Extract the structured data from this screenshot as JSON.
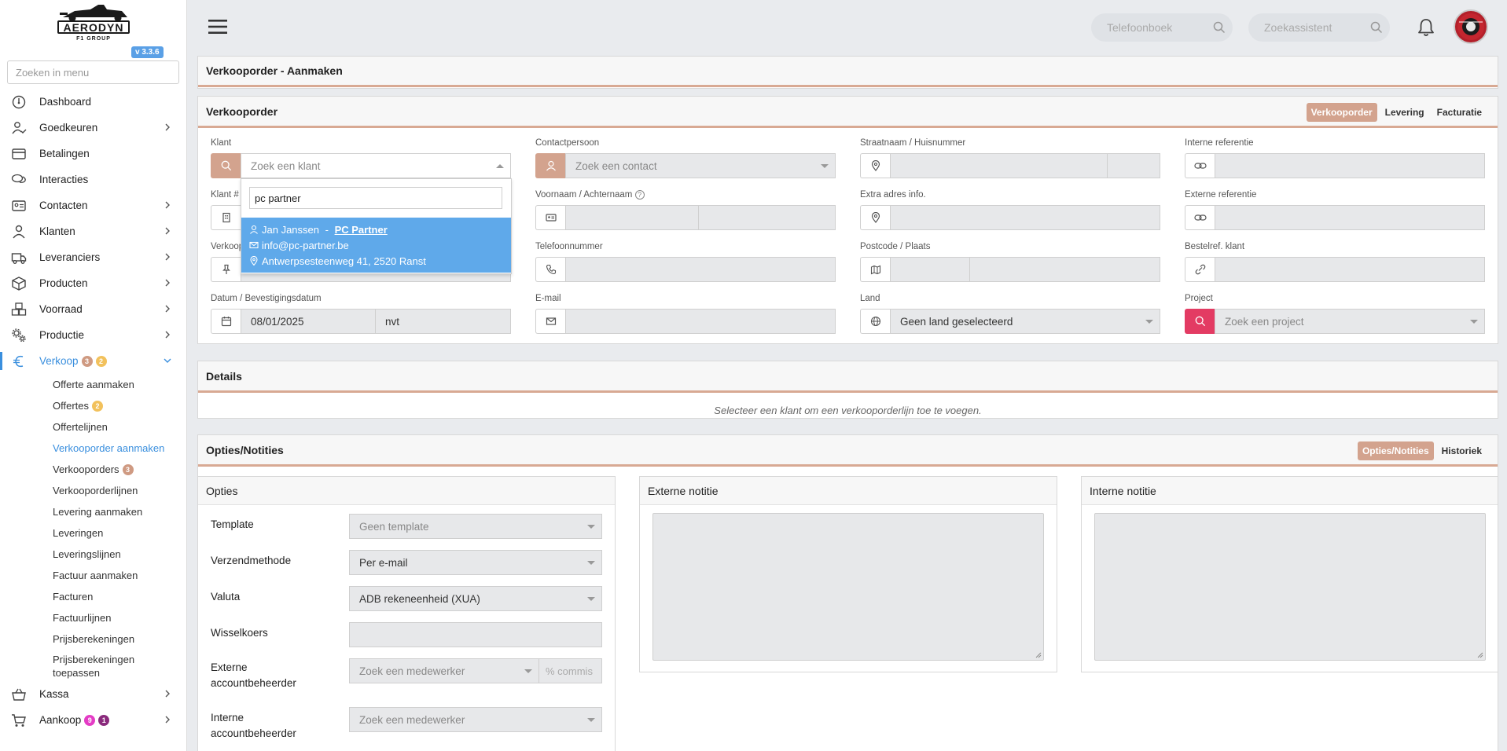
{
  "app": {
    "logo_text": "AERODYN",
    "logo_sub": "F1 GROUP",
    "version": "v 3.3.6"
  },
  "sidebar": {
    "search_placeholder": "Zoeken in menu",
    "items": [
      {
        "label": "Dashboard",
        "icon": "dashboard-icon"
      },
      {
        "label": "Goedkeuren",
        "icon": "user-check-icon",
        "chevron": true
      },
      {
        "label": "Betalingen",
        "icon": "credit-card-icon"
      },
      {
        "label": "Interacties",
        "icon": "chat-icon"
      },
      {
        "label": "Contacten",
        "icon": "contact-card-icon",
        "chevron": true
      },
      {
        "label": "Klanten",
        "icon": "user-icon",
        "chevron": true
      },
      {
        "label": "Leveranciers",
        "icon": "truck-icon",
        "chevron": true
      },
      {
        "label": "Producten",
        "icon": "box-icon",
        "chevron": true
      },
      {
        "label": "Voorraad",
        "icon": "boxes-icon",
        "chevron": true
      },
      {
        "label": "Productie",
        "icon": "gears-icon",
        "chevron": true
      }
    ],
    "verkoop": {
      "label": "Verkoop",
      "badge1": "3",
      "badge2": "2"
    },
    "verkoop_sub": [
      {
        "label": "Offerte aanmaken"
      },
      {
        "label": "Offertes",
        "badge": "2"
      },
      {
        "label": "Offertelijnen"
      },
      {
        "label": "Verkooporder aanmaken",
        "active": true
      },
      {
        "label": "Verkooporders",
        "badge": "3"
      },
      {
        "label": "Verkooporderlijnen"
      },
      {
        "label": "Levering aanmaken"
      },
      {
        "label": "Leveringen"
      },
      {
        "label": "Leveringslijnen"
      },
      {
        "label": "Factuur aanmaken"
      },
      {
        "label": "Facturen"
      },
      {
        "label": "Factuurlijnen"
      },
      {
        "label": "Prijsberekeningen"
      },
      {
        "label": "Prijsberekeningen toepassen"
      }
    ],
    "bottom": [
      {
        "label": "Kassa",
        "icon": "basket-icon",
        "chevron": true
      },
      {
        "label": "Aankoop",
        "icon": "cart-icon",
        "chevron": true,
        "badge1": "9",
        "badge2": "1"
      }
    ]
  },
  "topbar": {
    "phonebook_placeholder": "Telefoonboek",
    "assistant_placeholder": "Zoekassistent"
  },
  "breadcrumb": "Verkooporder - Aanmaken",
  "order": {
    "title": "Verkooporder",
    "tabs": [
      {
        "label": "Verkooporder",
        "active": true
      },
      {
        "label": "Levering"
      },
      {
        "label": "Facturatie"
      }
    ],
    "klant_label": "Klant",
    "klant_placeholder": "Zoek een klant",
    "klantnr_label": "Klant #",
    "verkoper_label": "Verkoop",
    "datum_label": "Datum / Bevestigingsdatum",
    "datum_value": "08/01/2025",
    "bevestiging_value": "nvt",
    "contact_label": "Contactpersoon",
    "contact_placeholder": "Zoek een contact",
    "naam_label": "Voornaam / Achternaam",
    "telefoon_label": "Telefoonnummer",
    "email_label": "E-mail",
    "straat_label": "Straatnaam / Huisnummer",
    "extra_label": "Extra adres info.",
    "postcode_label": "Postcode / Plaats",
    "land_label": "Land",
    "land_value": "Geen land geselecteerd",
    "intref_label": "Interne referentie",
    "extref_label": "Externe referentie",
    "bestelref_label": "Bestelref. klant",
    "project_label": "Project",
    "project_placeholder": "Zoek een project"
  },
  "dropdown": {
    "query": "pc partner",
    "result": {
      "name": "Jan Janssen",
      "separator": " - ",
      "company": "PC Partner",
      "email": "info@pc-partner.be",
      "address": "Antwerpsesteenweg 41, 2520 Ranst"
    }
  },
  "details": {
    "title": "Details",
    "empty": "Selecteer een klant om een verkooporderlijn toe te voegen."
  },
  "notes": {
    "title": "Opties/Notities",
    "tabs": [
      {
        "label": "Opties/Notities",
        "active": true
      },
      {
        "label": "Historiek"
      }
    ],
    "opties_title": "Opties",
    "externe_title": "Externe notitie",
    "interne_title": "Interne notitie",
    "template_label": "Template",
    "template_value": "Geen template",
    "verzend_label": "Verzendmethode",
    "verzend_value": "Per e-mail",
    "valuta_label": "Valuta",
    "valuta_value": "ADB rekeneenheid (XUA)",
    "wissel_label": "Wisselkoers",
    "ext_acc_label": "Externe accountbeheerder",
    "ext_acc_placeholder": "Zoek een medewerker",
    "commis_placeholder": "% commis",
    "int_acc_label": "Interne accountbeheerder",
    "int_acc_placeholder": "Zoek een medewerker"
  },
  "colors": {
    "accent": "#d3a38e",
    "primary": "#3a8fde",
    "highlight": "#5fa9ea",
    "project": "#e33b63"
  }
}
